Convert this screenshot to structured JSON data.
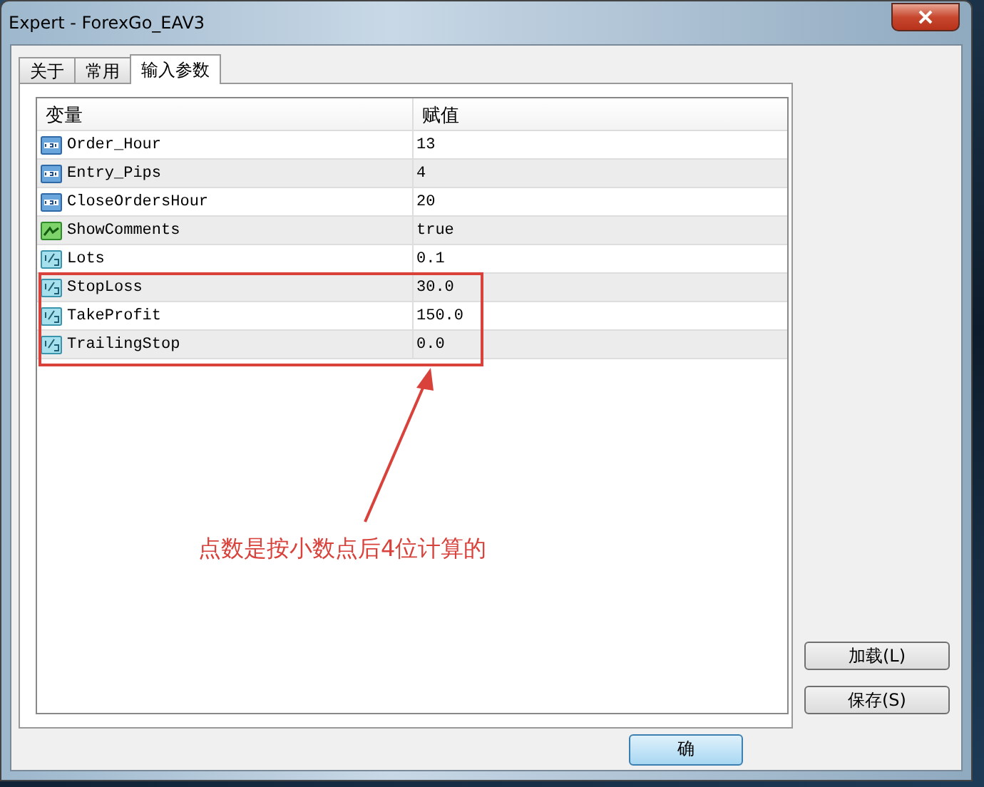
{
  "window": {
    "title": "Expert - ForexGo_EAV3"
  },
  "tabs": [
    {
      "label": "关于",
      "selected": false
    },
    {
      "label": "常用",
      "selected": false
    },
    {
      "label": "输入参数",
      "selected": true
    }
  ],
  "table": {
    "columns": [
      "变量",
      "赋值"
    ],
    "rows": [
      {
        "kind": "int",
        "name": "Order_Hour",
        "value": "13"
      },
      {
        "kind": "int",
        "name": "Entry_Pips",
        "value": "4"
      },
      {
        "kind": "int",
        "name": "CloseOrdersHour",
        "value": "20"
      },
      {
        "kind": "bool",
        "name": "ShowComments",
        "value": "true"
      },
      {
        "kind": "double",
        "name": "Lots",
        "value": "0.1"
      },
      {
        "kind": "double",
        "name": "StopLoss",
        "value": "30.0"
      },
      {
        "kind": "double",
        "name": "TakeProfit",
        "value": "150.0"
      },
      {
        "kind": "double",
        "name": "TrailingStop",
        "value": "0.0"
      }
    ]
  },
  "side_buttons": [
    "加载(L)",
    "保存(S)"
  ],
  "bottom_buttons": [
    "确"
  ],
  "annotation": {
    "text": "点数是按小数点后4位计算的"
  }
}
